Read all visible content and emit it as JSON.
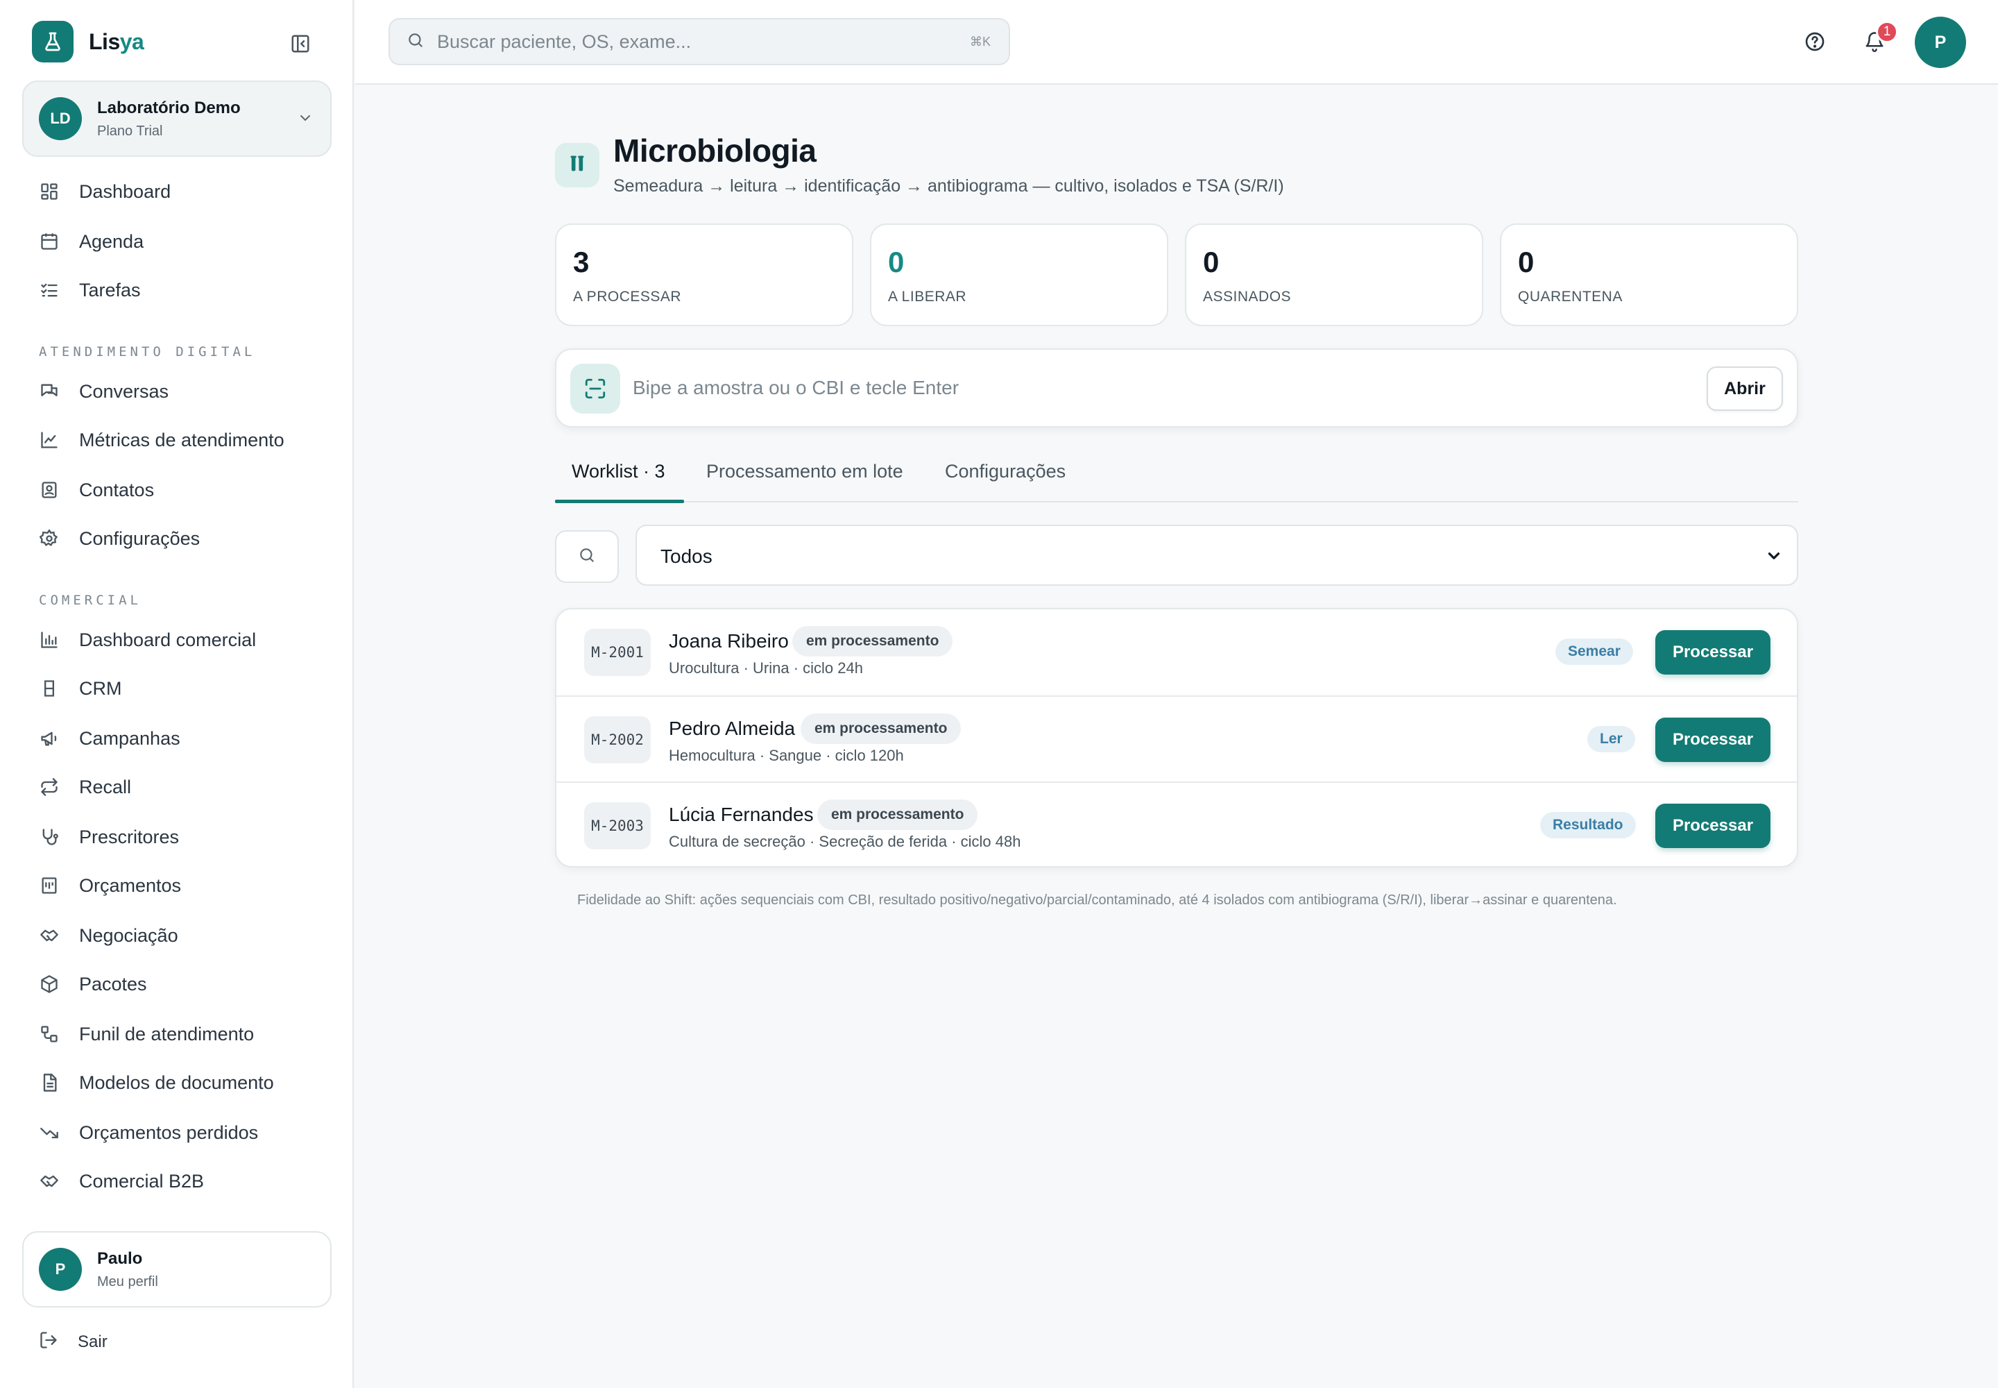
{
  "brand": {
    "name_main": "Lis",
    "name_accent": "ya"
  },
  "org": {
    "initials": "LD",
    "name": "Laboratório Demo",
    "plan": "Plano Trial"
  },
  "nav": {
    "main": [
      {
        "label": "Dashboard",
        "icon": "dashboard-icon"
      },
      {
        "label": "Agenda",
        "icon": "calendar-icon"
      },
      {
        "label": "Tarefas",
        "icon": "checklist-icon"
      }
    ],
    "section_digital": "ATENDIMENTO DIGITAL",
    "digital": [
      {
        "label": "Conversas",
        "icon": "chat-icon"
      },
      {
        "label": "Métricas de atendimento",
        "icon": "line-chart-icon"
      },
      {
        "label": "Contatos",
        "icon": "contact-icon"
      },
      {
        "label": "Configurações",
        "icon": "gear-icon"
      }
    ],
    "section_comercial": "COMERCIAL",
    "comercial": [
      {
        "label": "Dashboard comercial",
        "icon": "bar-chart-icon"
      },
      {
        "label": "CRM",
        "icon": "crm-icon"
      },
      {
        "label": "Campanhas",
        "icon": "megaphone-icon"
      },
      {
        "label": "Recall",
        "icon": "repeat-icon"
      },
      {
        "label": "Prescritores",
        "icon": "stethoscope-icon"
      },
      {
        "label": "Orçamentos",
        "icon": "receipt-icon"
      },
      {
        "label": "Negociação",
        "icon": "handshake-icon"
      },
      {
        "label": "Pacotes",
        "icon": "package-icon"
      },
      {
        "label": "Funil de atendimento",
        "icon": "workflow-icon"
      },
      {
        "label": "Modelos de documento",
        "icon": "document-icon"
      },
      {
        "label": "Orçamentos perdidos",
        "icon": "trending-down-icon"
      },
      {
        "label": "Comercial B2B",
        "icon": "handshake-icon"
      }
    ]
  },
  "user": {
    "initial": "P",
    "name": "Paulo",
    "sub": "Meu perfil"
  },
  "logout_label": "Sair",
  "topbar": {
    "search_placeholder": "Buscar paciente, OS, exame...",
    "shortcut": "⌘K",
    "notif_count": "1",
    "avatar_initial": "P"
  },
  "page": {
    "title": "Microbiologia",
    "subtitle": "Semeadura → leitura → identificação → antibiograma — cultivo, isolados e TSA (S/R/I)"
  },
  "stats": [
    {
      "value": "3",
      "label": "A PROCESSAR"
    },
    {
      "value": "0",
      "label": "A LIBERAR"
    },
    {
      "value": "0",
      "label": "ASSINADOS"
    },
    {
      "value": "0",
      "label": "QUARENTENA"
    }
  ],
  "scan": {
    "placeholder": "Bipe a amostra ou o CBI e tecle Enter",
    "button": "Abrir"
  },
  "tabs": [
    "Worklist · 3",
    "Processamento em lote",
    "Configurações"
  ],
  "filter": {
    "selected": "Todos"
  },
  "worklist": [
    {
      "id": "M-2001",
      "name": "Joana Ribeiro",
      "status": "em processamento",
      "meta": "Urocultura · Urina · ciclo 24h",
      "step": "Semear",
      "action": "Processar"
    },
    {
      "id": "M-2002",
      "name": "Pedro Almeida",
      "status": "em processamento",
      "meta": "Hemocultura · Sangue · ciclo 120h",
      "step": "Ler",
      "action": "Processar"
    },
    {
      "id": "M-2003",
      "name": "Lúcia Fernandes",
      "status": "em processamento",
      "meta": "Cultura de secreção · Secreção de ferida · ciclo 48h",
      "step": "Resultado",
      "action": "Processar"
    }
  ],
  "footnote": "Fidelidade ao Shift: ações sequenciais com CBI, resultado positivo/negativo/parcial/contaminado, até 4 isolados com antibiograma (S/R/I), liberar→assinar e quarentena.",
  "colors": {
    "primary": "#137b75",
    "accent_text": "#168a84",
    "badge_red": "#e04a58",
    "step_blue": "#3b7ea6"
  }
}
